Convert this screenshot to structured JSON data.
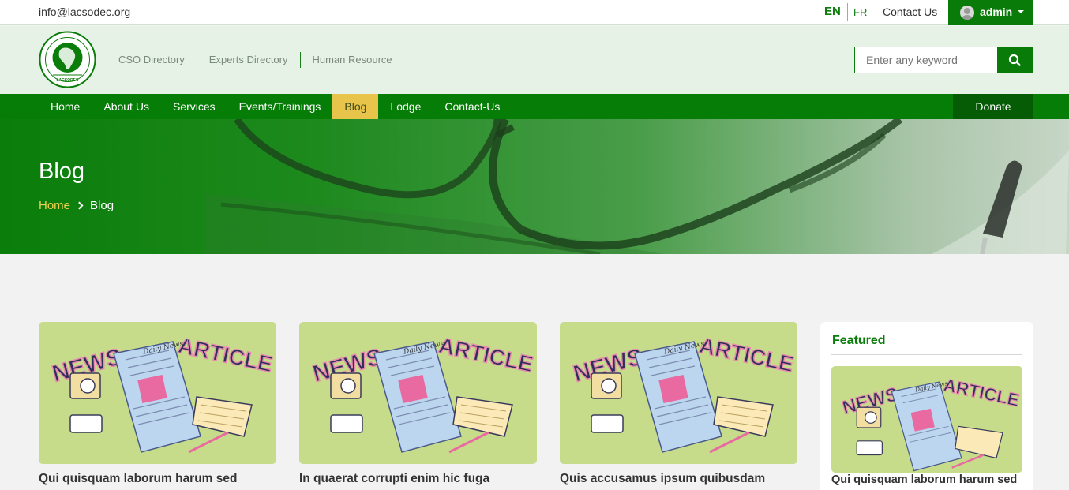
{
  "topbar": {
    "email": "info@lacsodec.org",
    "lang_active": "EN",
    "lang_alt": "FR",
    "contact": "Contact Us",
    "user": "admin"
  },
  "header": {
    "logo_text": "LACSODEC",
    "subnav": [
      "CSO Directory",
      "Experts Directory",
      "Human Resource"
    ],
    "search_placeholder": "Enter any keyword"
  },
  "nav": {
    "items": [
      {
        "label": "Home"
      },
      {
        "label": "About Us"
      },
      {
        "label": "Services"
      },
      {
        "label": "Events/Trainings"
      },
      {
        "label": "Blog",
        "active": true
      },
      {
        "label": "Lodge"
      },
      {
        "label": "Contact-Us"
      }
    ],
    "donate": "Donate"
  },
  "hero": {
    "title": "Blog",
    "breadcrumb_home": "Home",
    "breadcrumb_current": "Blog"
  },
  "image_text": {
    "news": "NEWS",
    "article": "ARTICLE",
    "paper": "Daily News"
  },
  "posts": [
    {
      "title": "Qui quisquam laborum harum sed"
    },
    {
      "title": "In quaerat corrupti enim hic fuga"
    },
    {
      "title": "Quis accusamus ipsum quibusdam"
    }
  ],
  "featured": {
    "heading": "Featured",
    "post_title": "Qui quisquam laborum harum sed"
  },
  "colors": {
    "brand_green": "#087b08",
    "accent_yellow": "#e8c44a",
    "thumb_bg": "#c6dc8a"
  }
}
